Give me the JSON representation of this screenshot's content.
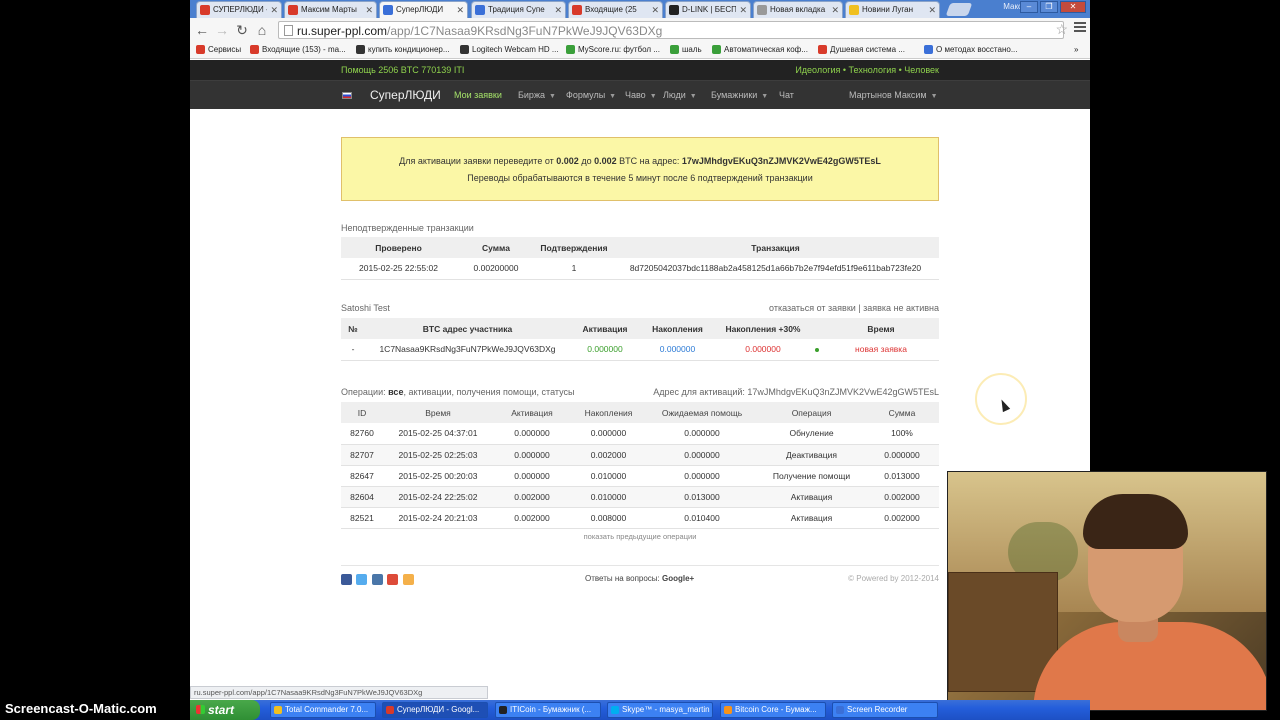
{
  "browser": {
    "tabs": [
      {
        "label": "СУПЕРЛЮДИ -",
        "color": "#d83a2a"
      },
      {
        "label": "Максим Марты",
        "color": "#d83a2a"
      },
      {
        "label": "СуперЛЮДИ",
        "color": "#3a6fd8",
        "active": true
      },
      {
        "label": "Традиция Супе",
        "color": "#3a6fd8"
      },
      {
        "label": "Входящие (25",
        "color": "#d83a2a"
      },
      {
        "label": "D-LINK | БЕСПР",
        "color": "#222222"
      },
      {
        "label": "Новая вкладка",
        "color": "#999999"
      },
      {
        "label": "Новини Луган",
        "color": "#f0c020"
      }
    ],
    "window_user": "Максим",
    "url_host": "ru.super-ppl.com",
    "url_path": "/app/1C7Nasaa9KRsdNg3FuN7PkWeJ9JQV63DXg",
    "bookmarks": [
      {
        "label": "Сервисы",
        "color": "#d83a2a"
      },
      {
        "label": "Входящие (153) - ma...",
        "color": "#d83a2a"
      },
      {
        "label": "купить кондиционер...",
        "color": "#333333"
      },
      {
        "label": "Logitech Webcam HD ...",
        "color": "#333333"
      },
      {
        "label": "MyScore.ru: футбол ...",
        "color": "#3a9f3a"
      },
      {
        "label": "шаль",
        "color": "#3a9f3a"
      },
      {
        "label": "Автоматическая коф...",
        "color": "#3a9f3a"
      },
      {
        "label": "Душевая система ...",
        "color": "#d83a2a"
      },
      {
        "label": "О методах восстано...",
        "color": "#3a6fd8"
      }
    ],
    "status_url": "ru.super-ppl.com/app/1C7Nasaa9KRsdNg3FuN7PkWeJ9JQV63DXg"
  },
  "site": {
    "topbar_left": "Помощь   2506 BTC   770139 ITI",
    "topbar_right": "Идеология • Технология • Человек",
    "brand": "СуперЛЮДИ",
    "nav": [
      {
        "label": "Мои заявки",
        "active": true
      },
      {
        "label": "Биржа",
        "caret": true
      },
      {
        "label": "Формулы",
        "caret": true
      },
      {
        "label": "Чаво",
        "caret": true
      },
      {
        "label": "Люди",
        "caret": true
      },
      {
        "label": "Бумажники",
        "caret": true
      },
      {
        "label": "Чат"
      }
    ],
    "user": "Мартынов Максим"
  },
  "alert": {
    "pre": "Для активации заявки переведите от ",
    "min": "0.002",
    "mid": " до ",
    "max": "0.002",
    "post": " BTC на адрес: ",
    "address": "17wJMhdgvEKuQ3nZJMVK2VwE42gGW5TEsL",
    "line2": "Переводы обрабатываются в течение 5 минут после 6 подтверждений транзакции"
  },
  "unconfirmed": {
    "title": "Неподтвержденные транзакции",
    "headers": [
      "Проверено",
      "Сумма",
      "Подтверждения",
      "Транзакция"
    ],
    "rows": [
      [
        "2015-02-25 22:55:02",
        "0.00200000",
        "1",
        "8d720504203​7bdc1188ab2a458125d1a66b7b2e7f94efd51f9e611bab723fe20"
      ]
    ]
  },
  "satoshi": {
    "title": "Satoshi Test",
    "actions": "отказаться от заявки | заявка не активна",
    "headers": [
      "№",
      "BTC адрес участника",
      "Активация",
      "Накопления",
      "Накопления +30%",
      "",
      "Время"
    ],
    "row": {
      "num": "-",
      "address": "1C7Nasaa9KRsdNg3FuN7PkWeJ9JQV63DXg",
      "activation": "0.000000",
      "savings": "0.000000",
      "savings30": "0.000000",
      "time": "новая заявка"
    }
  },
  "operations": {
    "filter_label": "Операции:",
    "filter_active": "все",
    "filters_rest": ",  активации,  получения помощи,  статусы",
    "activation_address": "Адрес для активаций: 17wJMhdgvEKuQ3nZJMVK2VwE42gGW5TEsL",
    "headers": [
      "ID",
      "Время",
      "Активация",
      "Накопления",
      "Ожидаемая помощь",
      "Операция",
      "Сумма"
    ],
    "rows": [
      [
        "82760",
        "2015-02-25 04:37:01",
        "0.000000",
        "0.000000",
        "0.000000",
        "Обнуление",
        "100%"
      ],
      [
        "82707",
        "2015-02-25 02:25:03",
        "0.000000",
        "0.002000",
        "0.000000",
        "Деактивация",
        "0.000000"
      ],
      [
        "82647",
        "2015-02-25 00:20:03",
        "0.000000",
        "0.010000",
        "0.000000",
        "Получение помощи",
        "0.013000"
      ],
      [
        "82604",
        "2015-02-24 22:25:02",
        "0.002000",
        "0.010000",
        "0.013000",
        "Активация",
        "0.002000"
      ],
      [
        "82521",
        "2015-02-24 20:21:03",
        "0.002000",
        "0.008000",
        "0.010400",
        "Активация",
        "0.002000"
      ]
    ],
    "more": "показать предыдущие операции"
  },
  "footer": {
    "center_text": "Ответы на вопросы: ",
    "center_bold": "Google+",
    "right": "© Powered by 2012-2014",
    "social_colors": [
      "#3b5998",
      "#55acee",
      "#4a76a8",
      "#dd4b39",
      "#f4b04a"
    ]
  },
  "taskbar": {
    "start": "start",
    "tasks": [
      {
        "label": "Total Commander 7.0...",
        "color": "#f0c020"
      },
      {
        "label": "СуперЛЮДИ - Googl...",
        "color": "#d83a2a",
        "active": true
      },
      {
        "label": "ITICoin - Бумажник (...",
        "color": "#222222"
      },
      {
        "label": "Skype™ - masya_martin",
        "color": "#00aff0"
      },
      {
        "label": "Bitcoin Core - Бумаж...",
        "color": "#f7931a"
      },
      {
        "label": "Screen Recorder",
        "color": "#3a6fd8"
      }
    ]
  },
  "watermark": "Screencast-O-Matic.com"
}
